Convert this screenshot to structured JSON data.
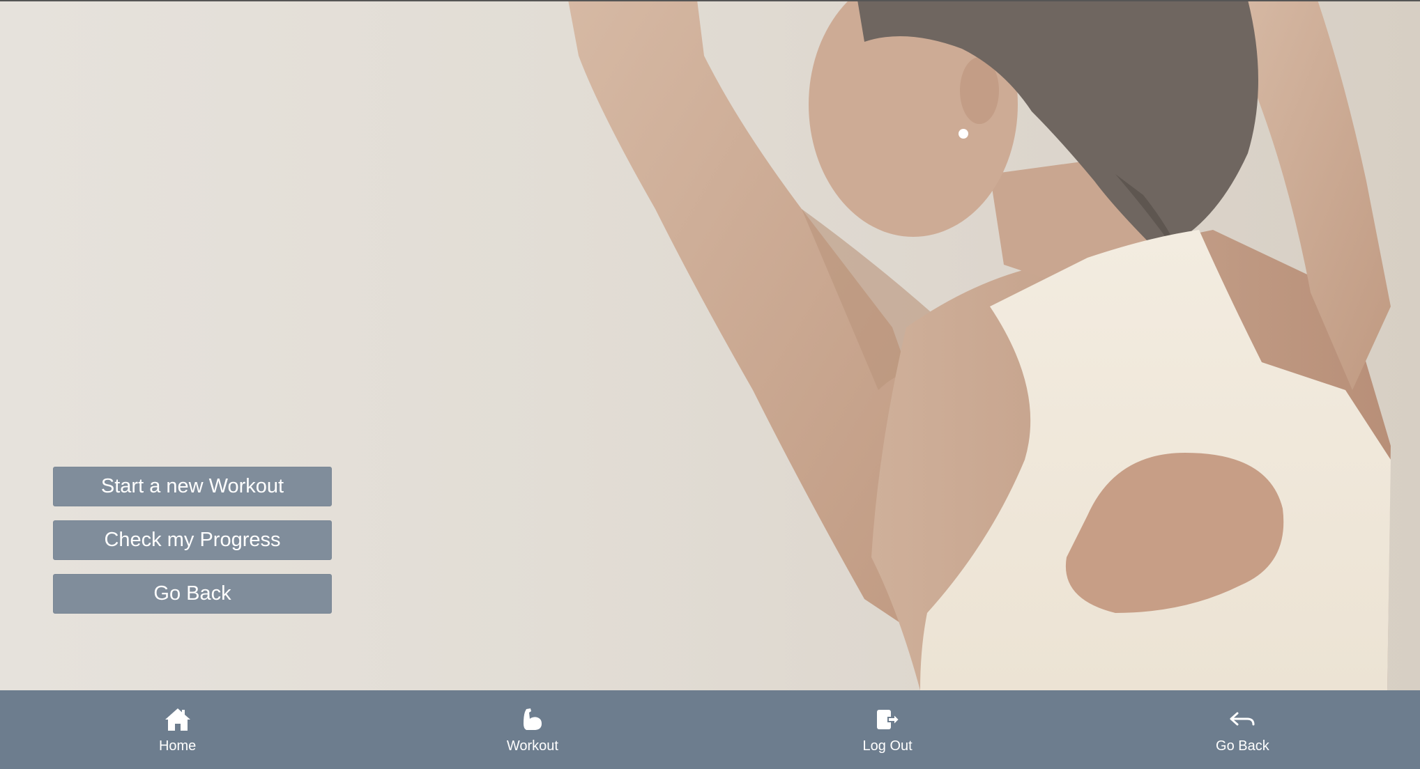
{
  "actions": {
    "start_workout": "Start a new Workout",
    "check_progress": "Check my Progress",
    "go_back": "Go Back"
  },
  "bottom_nav": {
    "items": [
      {
        "label": "Home",
        "icon": "home-icon"
      },
      {
        "label": "Workout",
        "icon": "flexed-bicep-icon"
      },
      {
        "label": "Log Out",
        "icon": "logout-icon"
      },
      {
        "label": "Go Back",
        "icon": "reply-arrow-icon"
      }
    ]
  },
  "colors": {
    "button_bg": "#808d9b",
    "nav_bg": "#6d7d8e",
    "text": "#ffffff",
    "background": "#e2ddd5"
  }
}
